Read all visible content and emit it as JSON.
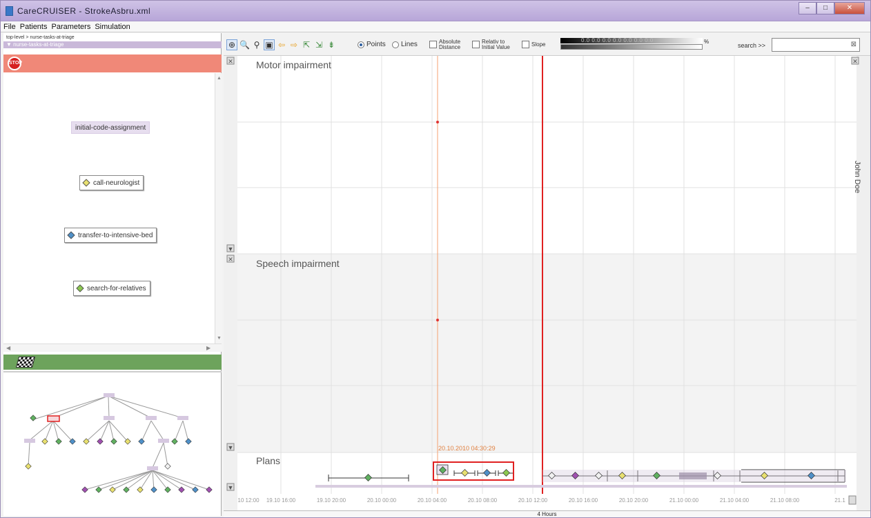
{
  "window": {
    "title": "CareCRUISER - StrokeAsbru.xml",
    "minimize": "–",
    "maximize": "□",
    "close": "✕"
  },
  "menu": [
    "File",
    "Patients",
    "Parameters",
    "Simulation"
  ],
  "left_panel": {
    "breadcrumb": "top-level > nurse-tasks-at-triage",
    "task_header": "nurse-tasks-at-triage",
    "stop_label": "STOP",
    "tasks": [
      {
        "label": "initial-code-assignment",
        "icon": "none"
      },
      {
        "label": "call-neurologist",
        "icon": "diamond",
        "color": "#e8e070"
      },
      {
        "label": "transfer-to-intensive-bed",
        "icon": "diamond",
        "color": "#4f90c8"
      },
      {
        "label": "search-for-relatives",
        "icon": "diamond",
        "color": "#8cc850"
      }
    ],
    "colors": {
      "stop_bar": "#f08878",
      "finish_bar": "#6da35c",
      "task_bg": "#e7deef"
    }
  },
  "toolbar": {
    "points_label": "Points",
    "lines_label": "Lines",
    "view_mode": "Points",
    "absolute_label_1": "Absolute",
    "absolute_label_2": "Distance",
    "relative_label_1": "Relativ to",
    "relative_label_2": "Initial Value",
    "slope_label": "Slope",
    "gradient_values": "0.0 0.0 0.0 0.0 0.0 0.0 0.0",
    "percent": "%",
    "search_label": "search >>",
    "search_value": "",
    "search_clear": "⊠"
  },
  "timeline": {
    "panels": [
      "Motor impairment",
      "Speech impairment",
      "Plans"
    ],
    "cursor_label": "20.10.2010 04:30:29",
    "ticks": [
      "10 12:00",
      "19.10 16:00",
      "19.10 20:00",
      "20.10 00:00",
      "20.10 04:00",
      "20.10 08:00",
      "20.10 12:00",
      "20.10 16:00",
      "20.10 20:00",
      "21.10 00:00",
      "21.10 04:00",
      "21.10 08:00",
      "21.1"
    ],
    "patient": "John Doe",
    "scale": "4 Hours",
    "colors": {
      "now_line": "#e02020",
      "cursor_line": "#f4a070",
      "plan_highlight": "#e02020"
    }
  }
}
